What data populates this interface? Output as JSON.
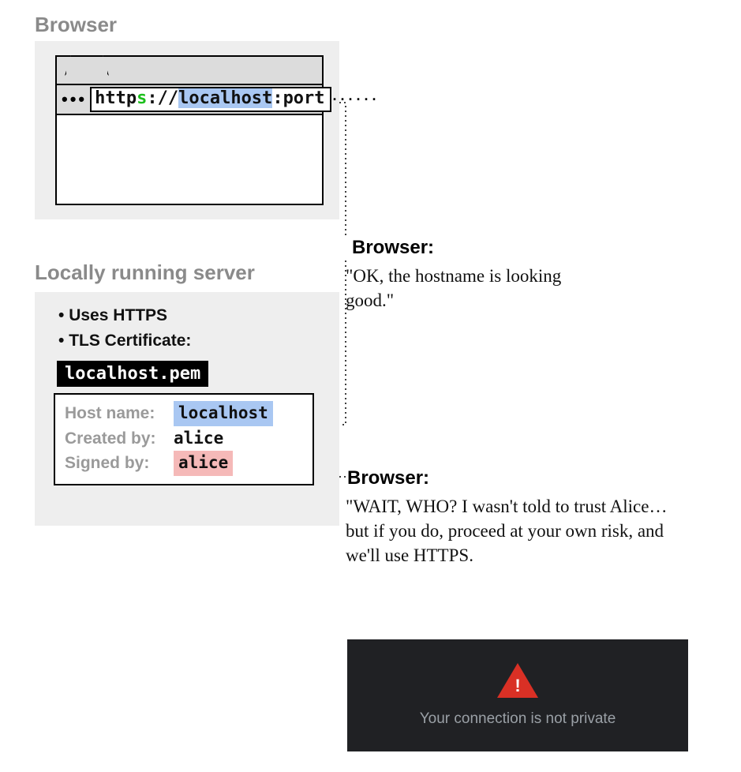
{
  "browser": {
    "section_label": "Browser",
    "url": {
      "prefix_dots": "•••",
      "scheme_http": "http",
      "scheme_s": "s",
      "scheme_sep": "://",
      "host": "localhost",
      "port_sep": ":",
      "port": "port",
      "trail_dots": "······"
    }
  },
  "server": {
    "section_label": "Locally running server",
    "bullets": [
      "Uses HTTPS",
      "TLS Certificate:"
    ],
    "cert_file": "localhost.pem",
    "cert": {
      "rows": [
        {
          "label": "Host name:",
          "value": "localhost",
          "highlight": "blue"
        },
        {
          "label": "Created by:",
          "value": "alice",
          "highlight": "none"
        },
        {
          "label": "Signed by:",
          "value": "alice",
          "highlight": "red"
        }
      ]
    }
  },
  "annotations": {
    "a1_heading": "Browser:",
    "a1_body": "\"OK, the hostname is looking good.\"",
    "a2_heading": "Browser:",
    "a2_body": "\"WAIT, WHO? I wasn't told to trust Alice… but if you do, proceed at your own risk, and we'll use HTTPS."
  },
  "error_card": {
    "bang": "!",
    "message": "Your connection is not private"
  }
}
